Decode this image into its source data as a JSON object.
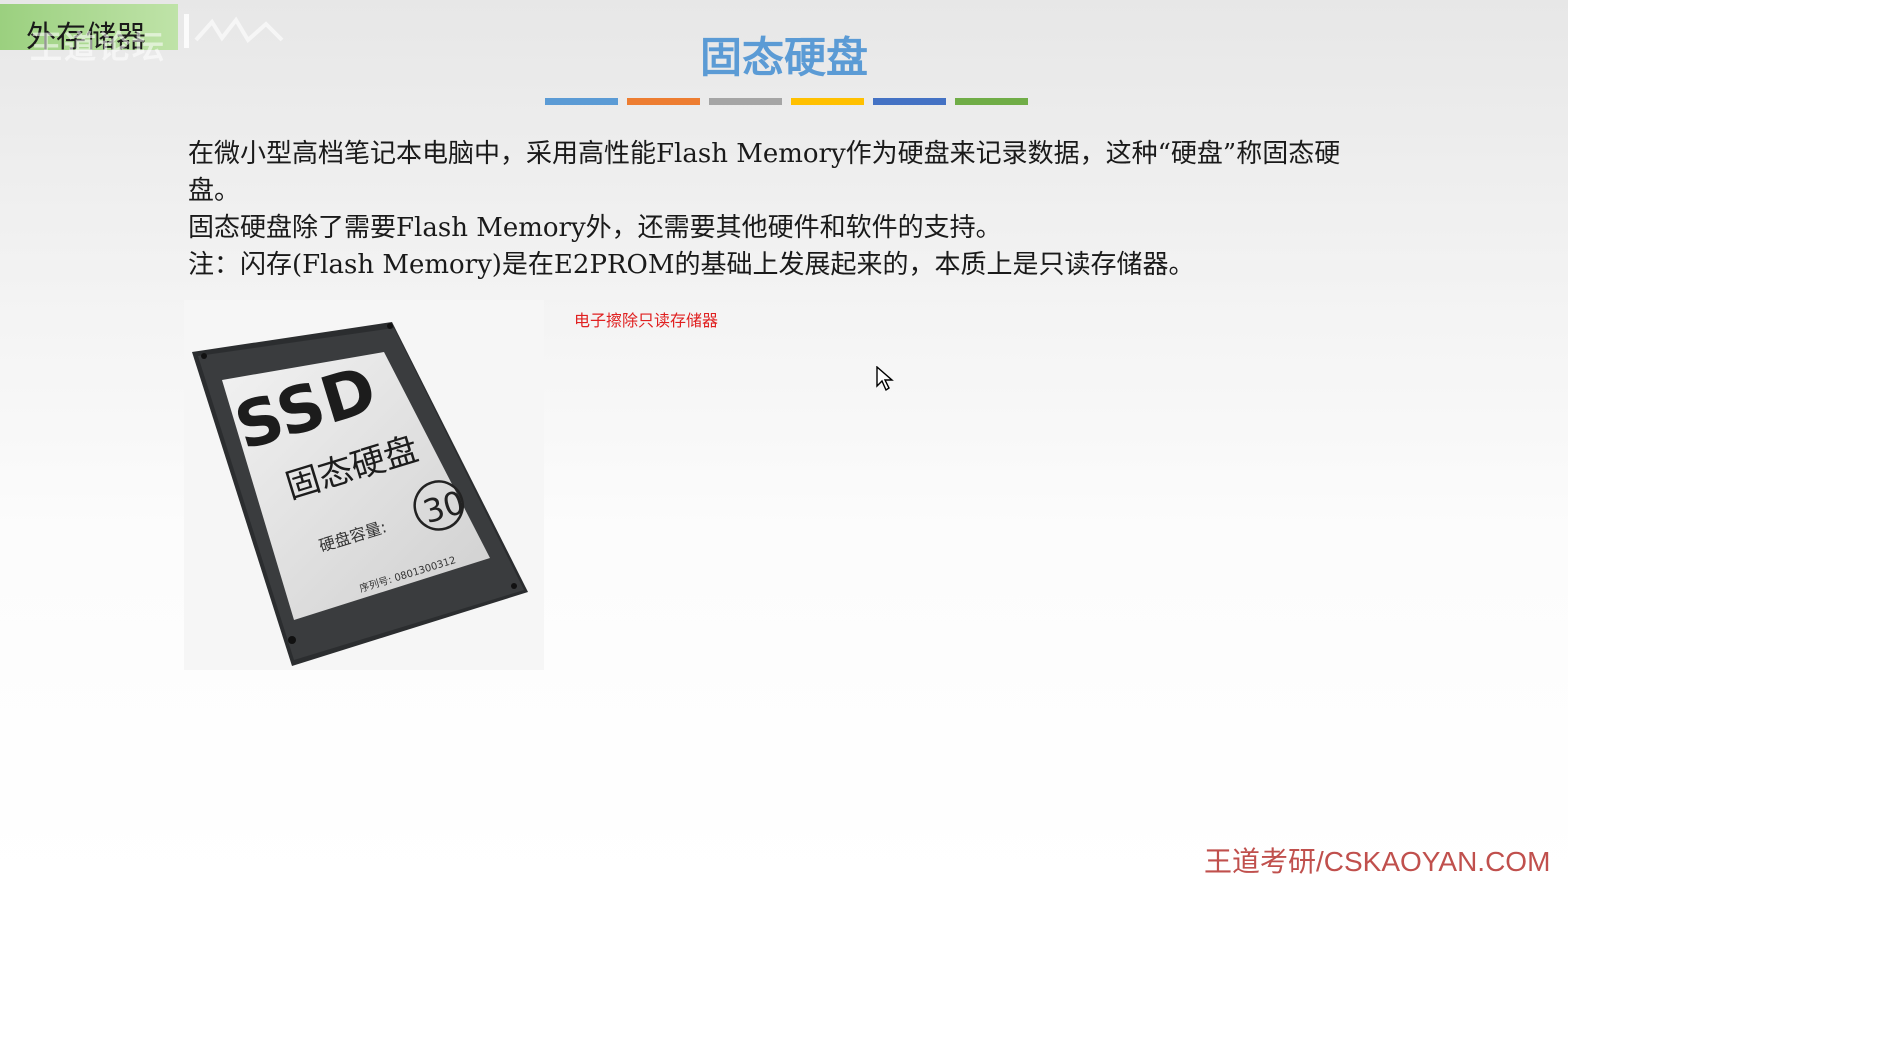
{
  "section_label": "外存储器",
  "watermark": {
    "text": "王道论坛"
  },
  "title": "固态硬盘",
  "color_bars": [
    "#5b9bd5",
    "#ed7d31",
    "#a5a5a5",
    "#ffc000",
    "#4472c4",
    "#70ad47"
  ],
  "paragraphs": [
    "在微小型高档笔记本电脑中，采用高性能Flash Memory作为硬盘来记录数据，这种“硬盘”称固态硬盘。",
    "固态硬盘除了需要Flash Memory外，还需要其他硬件和软件的支持。",
    "注：闪存(Flash Memory)是在E2PROM的基础上发展起来的，本质上是只读存储器。"
  ],
  "annotation": "电子擦除只读存储器",
  "ssd_image": {
    "label_main": "SSD",
    "label_cn": "固态硬盘",
    "capacity_label": "硬盘容量:",
    "capacity_value": "30",
    "serial": "序列号: 0801300312"
  },
  "footer_brand": "王道考研/CSKAOYAN.COM"
}
